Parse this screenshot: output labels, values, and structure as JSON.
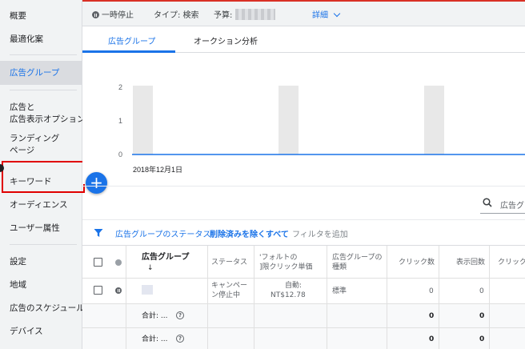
{
  "sidebar": {
    "items": [
      {
        "label": "概要"
      },
      {
        "label": "最適化案"
      },
      {
        "label": "広告グループ"
      },
      {
        "label": "広告と"
      },
      {
        "label": "広告表示オプション"
      },
      {
        "label": "ランディング"
      },
      {
        "label": "ページ"
      },
      {
        "label": "キーワード"
      },
      {
        "label": "オーディエンス"
      },
      {
        "label": "ユーザー属性"
      },
      {
        "label": "設定"
      },
      {
        "label": "地域"
      },
      {
        "label": "広告のスケジュール"
      },
      {
        "label": "デバイス"
      }
    ],
    "active_item": "広告グループ"
  },
  "topbar": {
    "status": "一時停止",
    "type": "タイプ: 検索",
    "budget_label": "予算:",
    "details": "詳細"
  },
  "tabs": [
    {
      "label": "広告グループ",
      "active": true
    },
    {
      "label": "オークション分析",
      "active": false
    }
  ],
  "chart_data": {
    "type": "line",
    "y_ticks": [
      "2",
      "1",
      "0"
    ],
    "ylim": [
      0,
      2
    ],
    "x_label_start": "2018年12月1日",
    "series": [
      {
        "values": [
          0,
          0,
          0,
          0,
          0,
          0,
          0,
          0,
          0,
          0,
          0,
          0,
          0,
          0,
          0,
          0,
          0,
          0,
          0,
          0,
          0,
          0,
          0,
          0,
          0,
          0,
          0,
          0,
          0,
          0,
          0
        ]
      }
    ],
    "weekend_bands": 3,
    "color": "#1a73e8"
  },
  "search": {
    "placeholder": "広告グ"
  },
  "filter": {
    "prefix": "広告グループのステータス:",
    "value": "削除済みを除くすべて",
    "add": "フィルタを追加"
  },
  "table": {
    "headers": {
      "name": "広告グループ",
      "sort_arrow": "↓",
      "status": "ステータス",
      "bid_line1": "'フォルトの",
      "bid_line2": "]限クリック単価",
      "type_line1": "広告グループの",
      "type_line2": "種類",
      "clicks": "クリック数",
      "impressions": "表示回数",
      "ctr": "クリック"
    },
    "rows": [
      {
        "status_line1": "キャンペー",
        "status_line2": "ン停止中",
        "bid_line1": "自動:",
        "bid_line2": "NT$12.78",
        "type": "標準",
        "clicks": "0",
        "impressions": "0"
      }
    ],
    "totals": [
      {
        "label": "合計: ...",
        "clicks": "0",
        "impressions": "0"
      },
      {
        "label": "合計: ...",
        "clicks": "0",
        "impressions": "0"
      }
    ]
  }
}
